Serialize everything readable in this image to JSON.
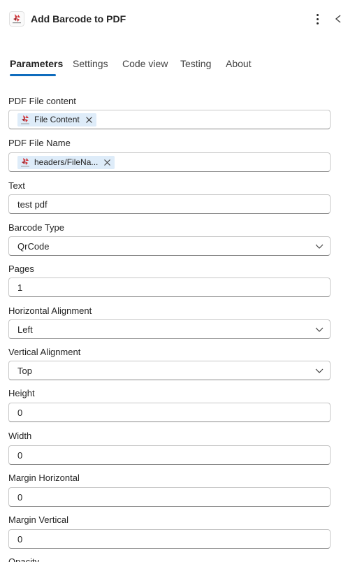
{
  "header": {
    "title": "Add Barcode to PDF",
    "icon": "app-logo-icon",
    "more_icon": "more-vertical-icon",
    "collapse_icon": "chevron-left-icon"
  },
  "tabs": [
    {
      "label": "Parameters",
      "active": true
    },
    {
      "label": "Settings",
      "active": false
    },
    {
      "label": "Code view",
      "active": false
    },
    {
      "label": "Testing",
      "active": false
    },
    {
      "label": "About",
      "active": false
    }
  ],
  "fields": {
    "pdf_file_content": {
      "label": "PDF File content",
      "token": "File Content"
    },
    "pdf_file_name": {
      "label": "PDF File Name",
      "token": "headers/FileNa..."
    },
    "text": {
      "label": "Text",
      "value": "test pdf"
    },
    "barcode_type": {
      "label": "Barcode Type",
      "value": "QrCode"
    },
    "pages": {
      "label": "Pages",
      "value": "1"
    },
    "horizontal_alignment": {
      "label": "Horizontal Alignment",
      "value": "Left"
    },
    "vertical_alignment": {
      "label": "Vertical Alignment",
      "value": "Top"
    },
    "height": {
      "label": "Height",
      "value": "0"
    },
    "width": {
      "label": "Width",
      "value": "0"
    },
    "margin_horizontal": {
      "label": "Margin Horizontal",
      "value": "0"
    },
    "margin_vertical": {
      "label": "Margin Vertical",
      "value": "0"
    },
    "opacity": {
      "label": "Opacity"
    }
  },
  "colors": {
    "accent": "#0f6cbd",
    "token_bg": "#deecf9",
    "logo_red": "#d13438",
    "border": "#c7c7c7"
  }
}
